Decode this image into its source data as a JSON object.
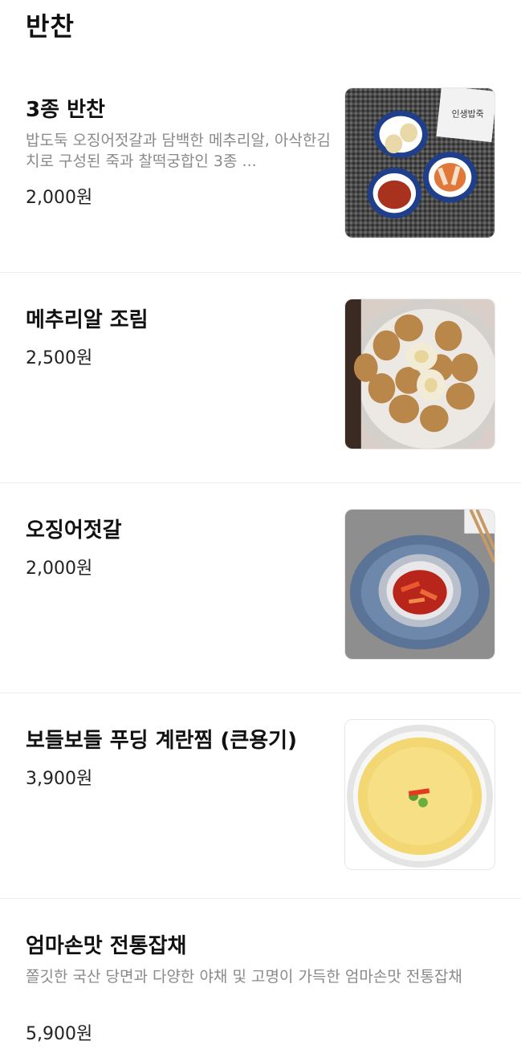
{
  "section": {
    "title": "반찬"
  },
  "items": [
    {
      "name": "3종 반찬",
      "description": "밥도둑 오징어젓갈과 담백한 메추리알, 아삭한김치로 구성된 죽과 찰떡궁합인 3종 ...",
      "price": "2,000원",
      "image_icon": "three-side-dishes-photo",
      "image_text": "인생밥죽"
    },
    {
      "name": "메추리알 조림",
      "price": "2,500원",
      "image_icon": "braised-quail-eggs-photo"
    },
    {
      "name": "오징어젓갈",
      "price": "2,000원",
      "image_icon": "squid-jeotgal-photo"
    },
    {
      "name": "보들보들 푸딩 계란찜 (큰용기)",
      "price": "3,900원",
      "image_icon": "steamed-egg-photo"
    },
    {
      "name": "엄마손맛 전통잡채",
      "description": "쫄깃한 국산 당면과 다양한 야채 및 고명이 가득한 엄마손맛 전통잡채",
      "price": "5,900원"
    }
  ]
}
